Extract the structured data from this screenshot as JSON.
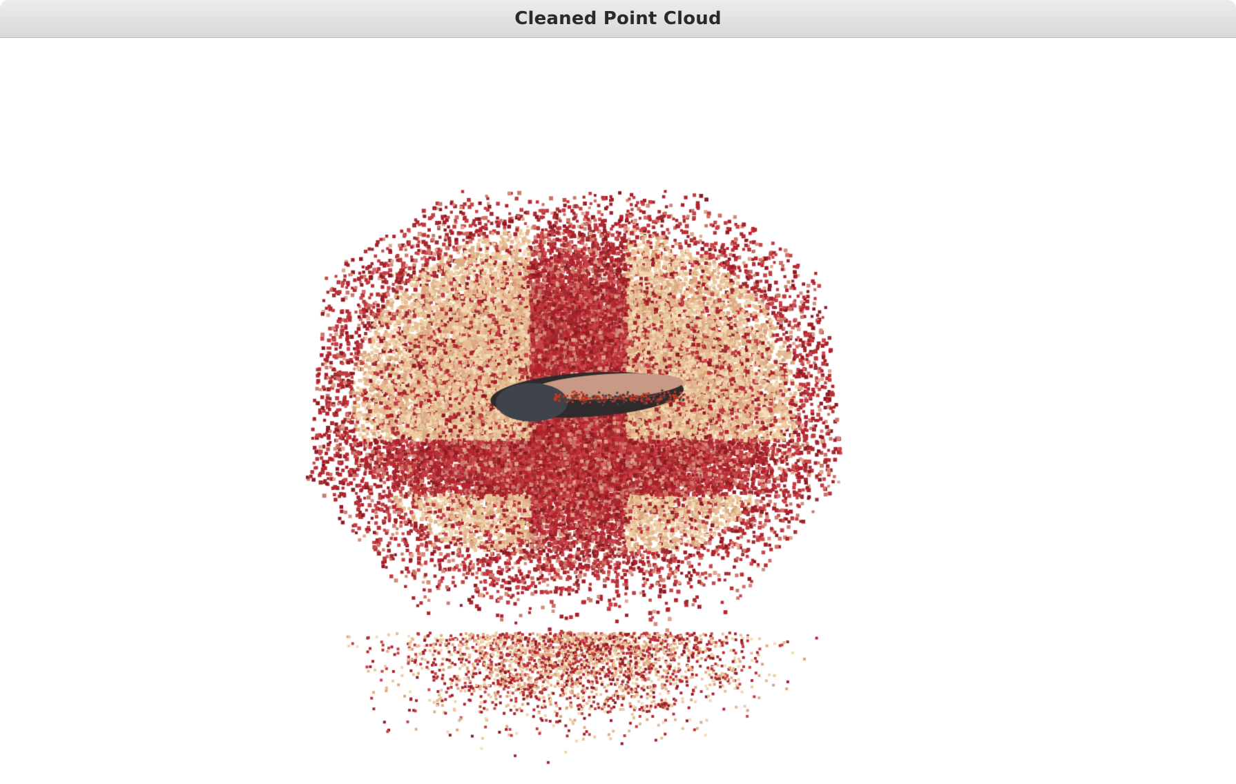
{
  "window": {
    "title": "Cleaned Point Cloud"
  },
  "viewport": {
    "background": "#ffffff",
    "palette": {
      "red": "#b5232e",
      "dark_red": "#8e1a22",
      "beige": "#ecc9a0",
      "tan": "#d9a57e",
      "dark_object": "#3c3f47"
    }
  }
}
